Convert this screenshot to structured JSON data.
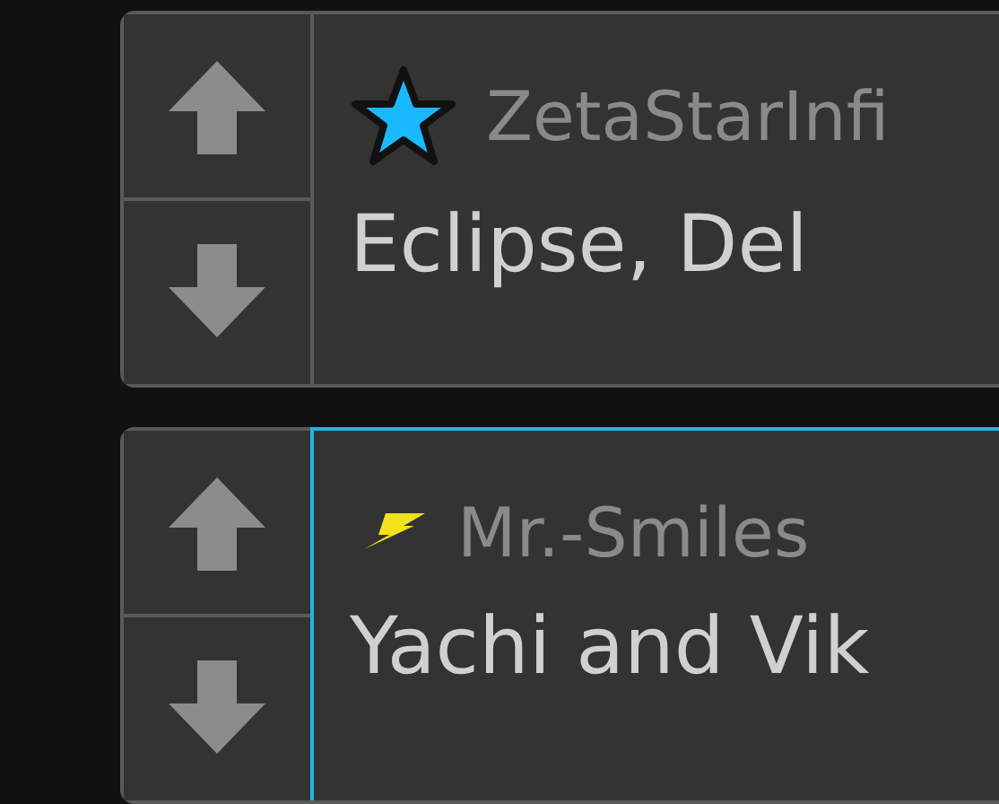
{
  "posts": [
    {
      "kind": "star",
      "author": "ZetaStarInfi",
      "title": "Eclipse, Del",
      "selected": false
    },
    {
      "kind": "bolt",
      "author": "Mr.-Smiles",
      "title": "Yachi and Vik",
      "selected": true
    }
  ]
}
